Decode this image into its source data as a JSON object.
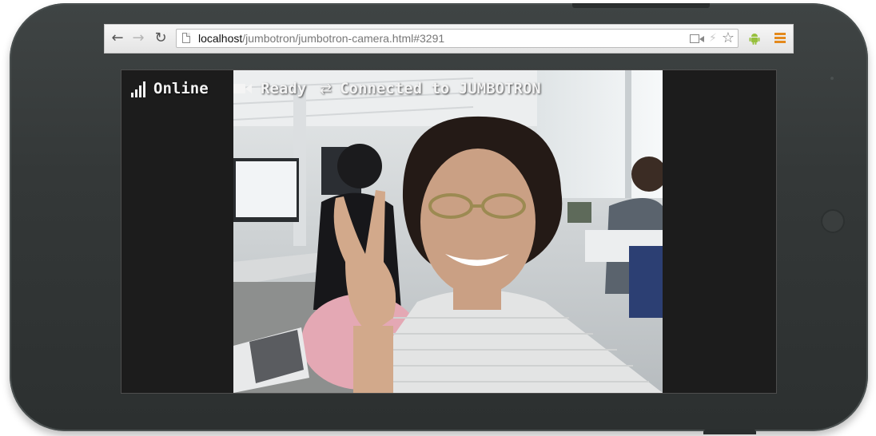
{
  "browser": {
    "url_host": "localhost",
    "url_path": "/jumbotron/jumbotron-camera.html#3291",
    "accent_menu": "#e48a1d",
    "accent_android": "#97c03d"
  },
  "status": {
    "online_label": "Online",
    "ready_label": "Ready",
    "connection_label": "Connected to JUMBOTRON"
  },
  "icons": {
    "back": "back-arrow-icon",
    "forward": "forward-arrow-icon",
    "reload": "reload-icon",
    "page": "page-icon",
    "camera": "camera-icon",
    "bolt": "lightning-icon",
    "star": "bookmark-star-icon",
    "android": "android-icon",
    "menu": "menu-icon",
    "signal": "signal-bars-icon",
    "video": "video-camera-icon",
    "swap": "swap-arrows-icon"
  }
}
